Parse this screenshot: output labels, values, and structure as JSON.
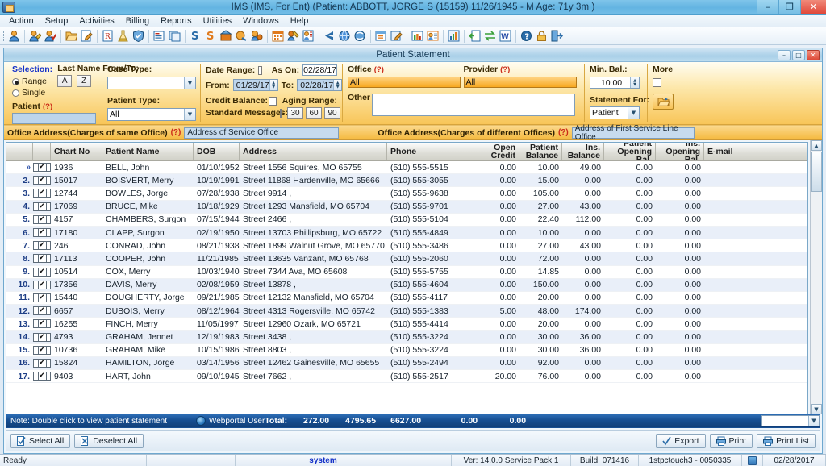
{
  "window": {
    "title": "IMS (IMS, For Ent)    (Patient: ABBOTT, JORGE S (15159) 11/26/1945 - M Age: 71y 3m )",
    "minimize": "–",
    "maximize": "❐",
    "close": "✕"
  },
  "menu": {
    "items": [
      "Action",
      "Setup",
      "Activities",
      "Billing",
      "Reports",
      "Utilities",
      "Windows",
      "Help"
    ]
  },
  "toolbar": {
    "icons": [
      "patient-icon",
      "patient-edit-icon",
      "patient-check-icon",
      "open-folder-icon",
      "edit-note-icon",
      "prescription-icon",
      "lab-flask-icon",
      "shield-icon",
      "chart-note-icon",
      "documents-icon",
      "charge-icon",
      "payment-icon",
      "bank-deposit-icon",
      "claim-icon",
      "insurance-icon",
      "calendar-icon",
      "scheduler-icon",
      "appointment-book-icon",
      "back-arrow-icon",
      "globe-icon",
      "globe-sync-icon",
      "report-window-icon",
      "report-edit-icon",
      "bar-chart-icon",
      "contact-card-icon",
      "analytics-icon",
      "import-icon",
      "exchange-icon",
      "word-export-icon",
      "help-icon",
      "lock-icon",
      "exit-icon"
    ]
  },
  "mdi": {
    "title": "Patient Statement",
    "minimize": "–",
    "maximize": "□",
    "close": "✕"
  },
  "filters": {
    "selection": {
      "label": "Selection:",
      "range_label": "Range",
      "single_label": "Single",
      "selected": "Range",
      "lastname_label": "Last Name From/To:",
      "from_letter": "A",
      "to_letter": "Z",
      "patient_label": "Patient",
      "patient_help": "(?)",
      "patient_value": ""
    },
    "case": {
      "case_type_label": "Case Type:",
      "case_type_value": "",
      "patient_type_label": "Patient Type:",
      "patient_type_value": "All"
    },
    "dates": {
      "date_range_label": "Date Range:",
      "date_range_checked": false,
      "as_on_label": "As On:",
      "as_on_value": "02/28/17",
      "from_label": "From:",
      "from_value": "01/29/17",
      "to_label": "To:",
      "to_value": "02/28/17",
      "credit_balance_label": "Credit Balance:",
      "credit_balance_checked": false,
      "standard_messages_label": "Standard Messages:",
      "standard_messages_checked": false,
      "aging_range_label": "Aging Range:",
      "aging_buttons": [
        "30",
        "60",
        "90"
      ]
    },
    "office": {
      "office_label": "Office",
      "office_help": "(?)",
      "office_value": "All",
      "provider_label": "Provider",
      "provider_help": "(?)",
      "provider_value": "All",
      "other_note_label": "Other Note:",
      "other_note_value": ""
    },
    "balance": {
      "min_bal_label": "Min. Bal.:",
      "min_bal_value": "10.00",
      "statement_for_label": "Statement For:",
      "statement_for_value": "Patient"
    },
    "more": {
      "label": "More",
      "checked": false,
      "folder_icon": "open-folder-icon"
    }
  },
  "address_bar": {
    "same_office_label": "Office Address(Charges of same Office)",
    "same_office_help": "(?)",
    "same_office_value": "Address of Service Office",
    "diff_office_label": "Office Address(Charges of different Offices)",
    "diff_office_help": "(?)",
    "diff_office_value": "Address of First Service Line Office"
  },
  "grid": {
    "columns": [
      "",
      "",
      "Chart No",
      "Patient Name",
      "DOB",
      "Address",
      "Phone",
      "Open Credit",
      "Patient Balance",
      "Ins. Balance",
      "Patient Opening Bal.",
      "Ins. Opening Bal.",
      "E-mail",
      ""
    ],
    "rows": [
      {
        "idx": "››",
        "checked": true,
        "chart": "1936",
        "name": "BELL, John",
        "dob": "01/10/1952",
        "address": "Street 1556 Squires, MO 65755",
        "phone": "(510) 555-5515",
        "open_credit": "0.00",
        "patient_balance": "10.00",
        "ins_balance": "49.00",
        "patient_opening": "0.00",
        "ins_opening": "0.00",
        "email": ""
      },
      {
        "idx": "2.",
        "checked": true,
        "chart": "15017",
        "name": "BOISVERT, Merry",
        "dob": "10/19/1991",
        "address": "Street 11868 Hardenville, MO 65666",
        "phone": "(510) 555-3055",
        "open_credit": "0.00",
        "patient_balance": "15.00",
        "ins_balance": "0.00",
        "patient_opening": "0.00",
        "ins_opening": "0.00",
        "email": ""
      },
      {
        "idx": "3.",
        "checked": true,
        "chart": "12744",
        "name": "BOWLES, Jorge",
        "dob": "07/28/1938",
        "address": "Street 9914 ,",
        "phone": "(510) 555-9638",
        "open_credit": "0.00",
        "patient_balance": "105.00",
        "ins_balance": "0.00",
        "patient_opening": "0.00",
        "ins_opening": "0.00",
        "email": ""
      },
      {
        "idx": "4.",
        "checked": true,
        "chart": "17069",
        "name": "BRUCE, Mike",
        "dob": "10/18/1929",
        "address": "Street 1293 Mansfield, MO 65704",
        "phone": "(510) 555-9701",
        "open_credit": "0.00",
        "patient_balance": "27.00",
        "ins_balance": "43.00",
        "patient_opening": "0.00",
        "ins_opening": "0.00",
        "email": ""
      },
      {
        "idx": "5.",
        "checked": true,
        "chart": "4157",
        "name": "CHAMBERS, Surgon",
        "dob": "07/15/1944",
        "address": "Street 2466 ,",
        "phone": "(510) 555-5104",
        "open_credit": "0.00",
        "patient_balance": "22.40",
        "ins_balance": "112.00",
        "patient_opening": "0.00",
        "ins_opening": "0.00",
        "email": ""
      },
      {
        "idx": "6.",
        "checked": true,
        "chart": "17180",
        "name": "CLAPP, Surgon",
        "dob": "02/19/1950",
        "address": "Street 13703 Phillipsburg, MO 65722",
        "phone": "(510) 555-4849",
        "open_credit": "0.00",
        "patient_balance": "10.00",
        "ins_balance": "0.00",
        "patient_opening": "0.00",
        "ins_opening": "0.00",
        "email": ""
      },
      {
        "idx": "7.",
        "checked": true,
        "chart": "246",
        "name": "CONRAD, John",
        "dob": "08/21/1938",
        "address": "Street 1899 Walnut Grove, MO 65770",
        "phone": "(510) 555-3486",
        "open_credit": "0.00",
        "patient_balance": "27.00",
        "ins_balance": "43.00",
        "patient_opening": "0.00",
        "ins_opening": "0.00",
        "email": ""
      },
      {
        "idx": "8.",
        "checked": true,
        "chart": "17113",
        "name": "COOPER, John",
        "dob": "11/21/1985",
        "address": "Street 13635 Vanzant, MO 65768",
        "phone": "(510) 555-2060",
        "open_credit": "0.00",
        "patient_balance": "72.00",
        "ins_balance": "0.00",
        "patient_opening": "0.00",
        "ins_opening": "0.00",
        "email": ""
      },
      {
        "idx": "9.",
        "checked": true,
        "chart": "10514",
        "name": "COX, Merry",
        "dob": "10/03/1940",
        "address": "Street 7344 Ava, MO 65608",
        "phone": "(510) 555-5755",
        "open_credit": "0.00",
        "patient_balance": "14.85",
        "ins_balance": "0.00",
        "patient_opening": "0.00",
        "ins_opening": "0.00",
        "email": ""
      },
      {
        "idx": "10.",
        "checked": true,
        "chart": "17356",
        "name": "DAVIS, Merry",
        "dob": "02/08/1959",
        "address": "Street 13878 ,",
        "phone": "(510) 555-4604",
        "open_credit": "0.00",
        "patient_balance": "150.00",
        "ins_balance": "0.00",
        "patient_opening": "0.00",
        "ins_opening": "0.00",
        "email": ""
      },
      {
        "idx": "11.",
        "checked": true,
        "chart": "15440",
        "name": "DOUGHERTY, Jorge",
        "dob": "09/21/1985",
        "address": "Street 12132 Mansfield, MO 65704",
        "phone": "(510) 555-4117",
        "open_credit": "0.00",
        "patient_balance": "20.00",
        "ins_balance": "0.00",
        "patient_opening": "0.00",
        "ins_opening": "0.00",
        "email": ""
      },
      {
        "idx": "12.",
        "checked": true,
        "chart": "6657",
        "name": "DUBOIS, Merry",
        "dob": "08/12/1964",
        "address": "Street 4313 Rogersville, MO 65742",
        "phone": "(510) 555-1383",
        "open_credit": "5.00",
        "patient_balance": "48.00",
        "ins_balance": "174.00",
        "patient_opening": "0.00",
        "ins_opening": "0.00",
        "email": ""
      },
      {
        "idx": "13.",
        "checked": true,
        "chart": "16255",
        "name": "FINCH, Merry",
        "dob": "11/05/1997",
        "address": "Street 12960 Ozark, MO 65721",
        "phone": "(510) 555-4414",
        "open_credit": "0.00",
        "patient_balance": "20.00",
        "ins_balance": "0.00",
        "patient_opening": "0.00",
        "ins_opening": "0.00",
        "email": ""
      },
      {
        "idx": "14.",
        "checked": true,
        "chart": "4793",
        "name": "GRAHAM, Jennet",
        "dob": "12/19/1983",
        "address": "Street 3438 ,",
        "phone": "(510) 555-3224",
        "open_credit": "0.00",
        "patient_balance": "30.00",
        "ins_balance": "36.00",
        "patient_opening": "0.00",
        "ins_opening": "0.00",
        "email": ""
      },
      {
        "idx": "15.",
        "checked": true,
        "chart": "10736",
        "name": "GRAHAM, Mike",
        "dob": "10/15/1986",
        "address": "Street 8803 ,",
        "phone": "(510) 555-3224",
        "open_credit": "0.00",
        "patient_balance": "30.00",
        "ins_balance": "36.00",
        "patient_opening": "0.00",
        "ins_opening": "0.00",
        "email": ""
      },
      {
        "idx": "16.",
        "checked": true,
        "chart": "15824",
        "name": "HAMILTON, Jorge",
        "dob": "03/14/1956",
        "address": "Street 12462 Gainesville, MO 65655",
        "phone": "(510) 555-2494",
        "open_credit": "0.00",
        "patient_balance": "92.00",
        "ins_balance": "0.00",
        "patient_opening": "0.00",
        "ins_opening": "0.00",
        "email": ""
      },
      {
        "idx": "17.",
        "checked": true,
        "chart": "9403",
        "name": "HART, John",
        "dob": "09/10/1945",
        "address": "Street 7662 ,",
        "phone": "(510) 555-2517",
        "open_credit": "20.00",
        "patient_balance": "76.00",
        "ins_balance": "0.00",
        "patient_opening": "0.00",
        "ins_opening": "0.00",
        "email": ""
      }
    ]
  },
  "totals_bar": {
    "note": "Note: Double click to view patient statement",
    "webportal_icon": "globe-icon",
    "webportal_label": "Webportal User",
    "total_label": "Total:",
    "open_credit": "272.00",
    "patient_balance": "4795.65",
    "ins_balance": "6627.00",
    "patient_opening": "0.00",
    "ins_opening": "0.00",
    "combo_value": ""
  },
  "buttons": {
    "select_all": "Select All",
    "deselect_all": "Deselect All",
    "export": "Export",
    "print": "Print",
    "print_list": "Print List"
  },
  "statusbar": {
    "ready": "Ready",
    "blank1": "",
    "system": "system",
    "blank2": "",
    "version": "Ver: 14.0.0 Service Pack 1",
    "build": "Build: 071416",
    "machine": "1stpctouch3 - 0050335",
    "tray_icon": "app-tray-icon",
    "date": "02/28/2017"
  },
  "colors": {
    "accent_blue": "#1431c8",
    "filter_orange": "#f8c558",
    "title_blue": "#63b4e2",
    "totals_blue": "#174f92",
    "help_red": "#cc2a18"
  }
}
